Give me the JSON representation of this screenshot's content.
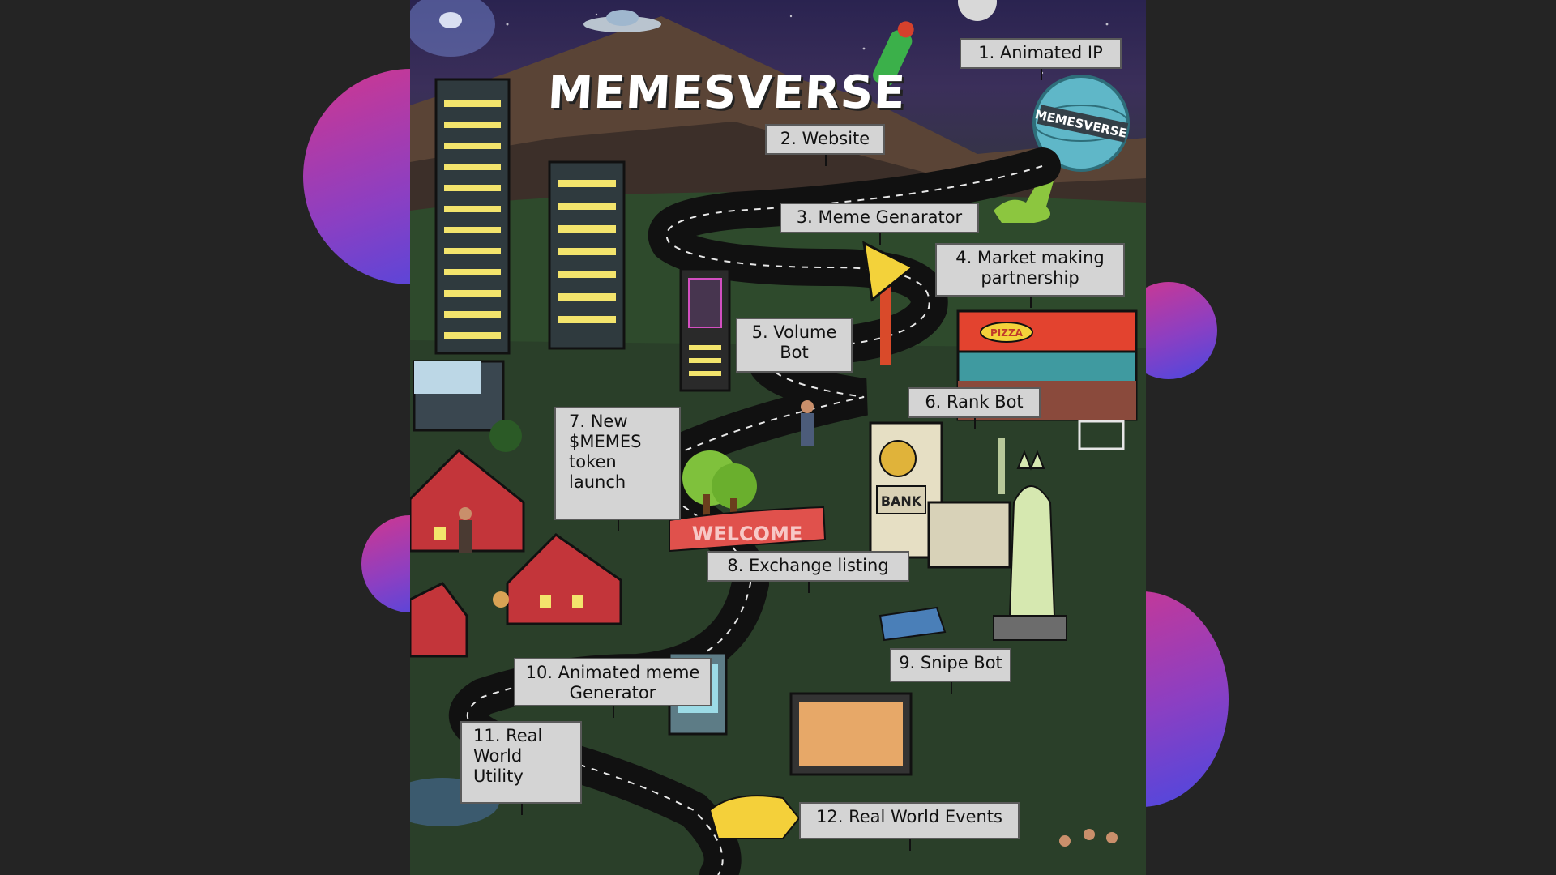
{
  "logo": "MEMESVERSE",
  "globe_text": "MEMESVERSE",
  "roadmap": [
    {
      "label": "1. Animated IP"
    },
    {
      "label": "2. Website"
    },
    {
      "label": "3. Meme Genarator"
    },
    {
      "label": "4. Market making\npartnership"
    },
    {
      "label": "5. Volume\nBot"
    },
    {
      "label": "6. Rank Bot"
    },
    {
      "label": "7. New\n$MEMES\ntoken\nlaunch"
    },
    {
      "label": "8. Exchange listing"
    },
    {
      "label": "9. Snipe Bot"
    },
    {
      "label": "10. Animated meme\nGenerator"
    },
    {
      "label": "11. Real\nWorld\nUtility"
    },
    {
      "label": "12. Real World Events"
    }
  ],
  "signs": {
    "pizza": "PIZZA",
    "bank": "BANK",
    "welcome": "WELCOME"
  },
  "colors": {
    "background": "#242424",
    "accent_pink": "#d0378f",
    "accent_blue": "#4a48e0",
    "label_bg": "#d4d4d4"
  }
}
